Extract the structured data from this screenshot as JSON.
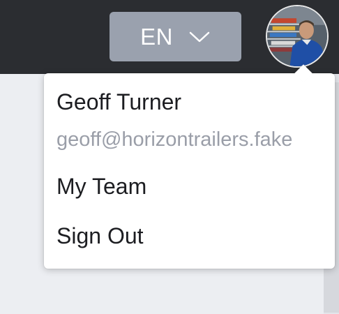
{
  "header": {
    "language_button": {
      "label": "EN",
      "icon": "chevron-down-icon"
    },
    "avatar": {
      "icon": "user-avatar"
    }
  },
  "account_menu": {
    "name": "Geoff Turner",
    "email": "geoff@horizontrailers.fake",
    "items": [
      {
        "label": "My Team"
      },
      {
        "label": "Sign Out"
      }
    ]
  },
  "colors": {
    "topbar": "#2b2d31",
    "language_button": "#9aa1ae",
    "menu_background": "#ffffff",
    "email_text": "#9a9ea8"
  }
}
